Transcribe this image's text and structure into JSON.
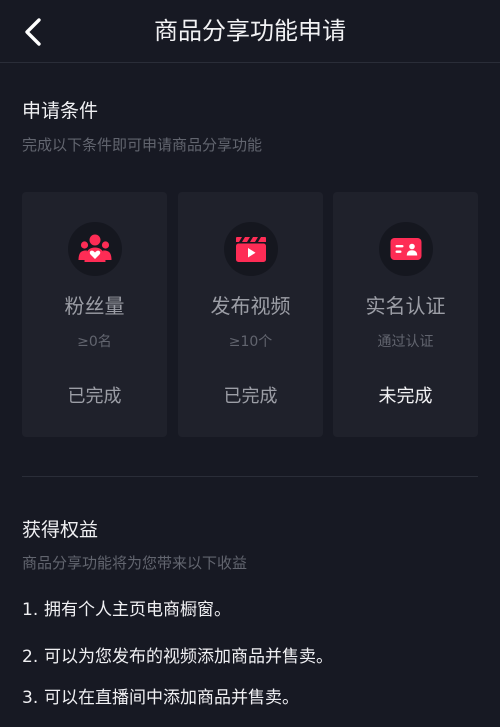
{
  "header": {
    "title": "商品分享功能申请"
  },
  "conditions": {
    "title": "申请条件",
    "subtitle": "完成以下条件即可申请商品分享功能",
    "items": [
      {
        "icon": "fans-icon",
        "name": "粉丝量",
        "requirement": "≥0名",
        "status": "已完成"
      },
      {
        "icon": "video-icon",
        "name": "发布视频",
        "requirement": "≥10个",
        "status": "已完成"
      },
      {
        "icon": "id-card-icon",
        "name": "实名认证",
        "requirement": "通过认证",
        "status": "未完成"
      }
    ]
  },
  "benefits": {
    "title": "获得权益",
    "subtitle": "商品分享功能将为您带来以下收益",
    "items": [
      {
        "num": "1.",
        "text": "拥有个人主页电商橱窗。"
      },
      {
        "num": "2.",
        "text": "可以为您发布的视频添加商品并售卖。"
      },
      {
        "num": "3.",
        "text": "可以在直播间中添加商品并售卖。"
      }
    ]
  },
  "colors": {
    "background": "#171923",
    "card": "#1f212b",
    "accent": "#fe2c55",
    "text_primary": "#f2f2f4",
    "text_secondary": "#9c9ea6",
    "text_muted": "#62656f"
  }
}
